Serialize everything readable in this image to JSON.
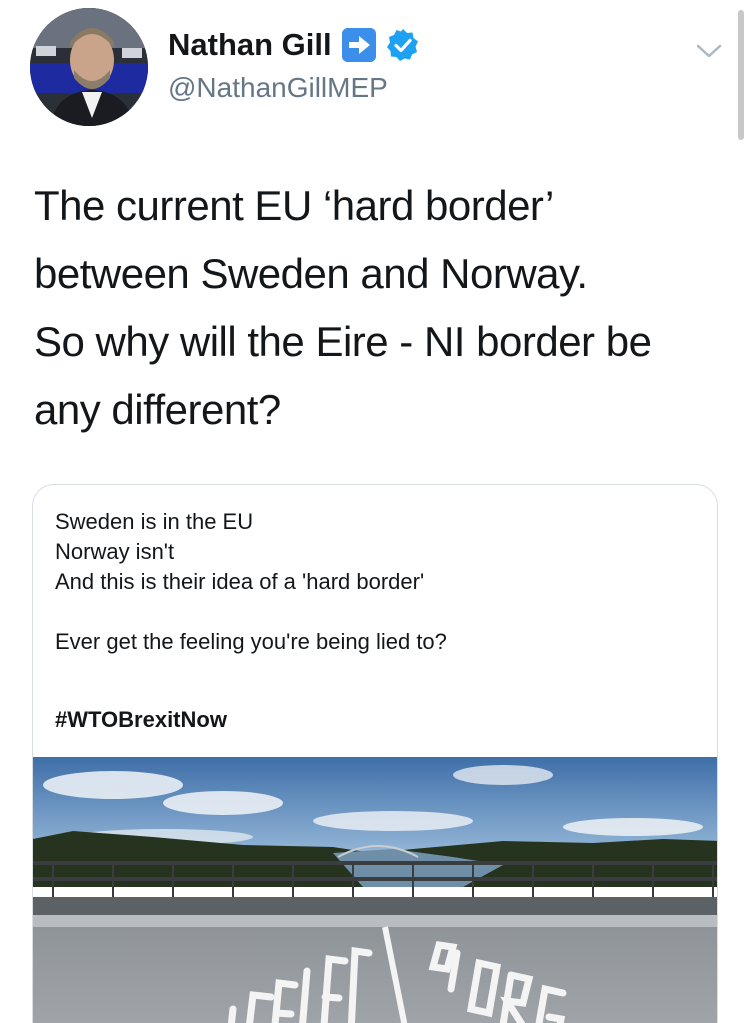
{
  "tweet": {
    "author": {
      "display_name": "Nathan Gill",
      "handle": "@NathanGillMEP",
      "badge_icon": "right-arrow-emoji-icon",
      "verified_icon": "verified-badge-icon"
    },
    "text_lines": [
      "The current EU ‘hard border’",
      "between Sweden and Norway.",
      "So why will the Eire - NI border be",
      "any different?"
    ],
    "menu_icon": "chevron-down-icon"
  },
  "quoted": {
    "lines": [
      "Sweden is in the EU",
      "Norway isn't",
      "And this is their idea of a 'hard border'",
      "",
      "Ever get the feeling you're being lied to?"
    ],
    "hashtag": "#WTOBrexitNow",
    "photo_road_text_left": "SVERIGE",
    "photo_road_text_right": "NORGE"
  },
  "colors": {
    "text": "#14171a",
    "secondary": "#657786",
    "verified_blue": "#1da1f2",
    "emoji_blue": "#3b8eea",
    "border": "#d8dde2"
  }
}
